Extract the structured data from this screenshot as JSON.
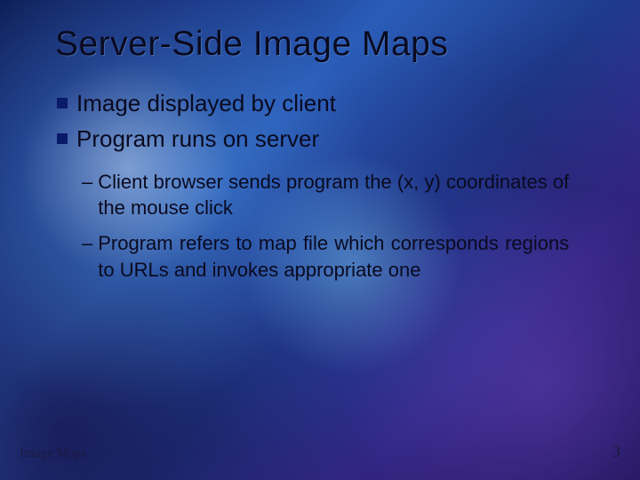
{
  "slide": {
    "title": "Server-Side Image Maps",
    "bullets": [
      {
        "text": "Image displayed by client"
      },
      {
        "text": "Program runs on server"
      }
    ],
    "subbullets": [
      {
        "text": "Client browser sends program the (x, y) coordinates of the mouse click"
      },
      {
        "text": "Program refers to map file which corresponds regions to URLs and invokes appropriate one"
      }
    ],
    "footer_label": "Image Maps",
    "page_number": "3"
  }
}
